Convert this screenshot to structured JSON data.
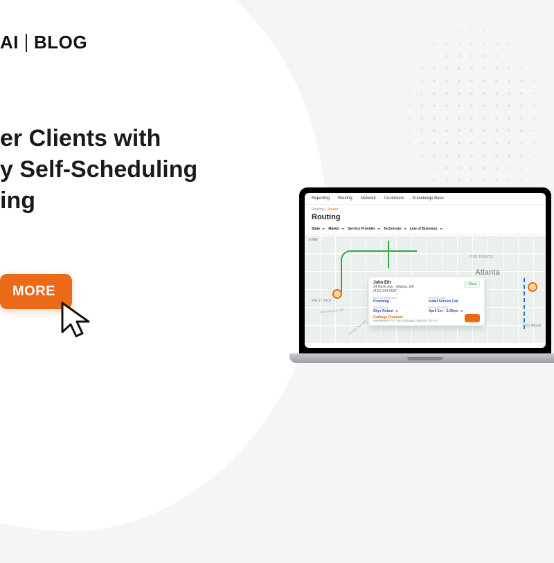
{
  "brand": {
    "prefix": "AI",
    "section": "BLOG"
  },
  "headline": {
    "line1": "er Clients with",
    "line2": "y Self-Scheduling",
    "line3": "ing"
  },
  "cta": {
    "label": "MORE"
  },
  "app": {
    "nav": {
      "reporting": "Reporting",
      "routing": "Routing",
      "network": "Network",
      "customers": "Customers",
      "knowledge": "Knowledge Base"
    },
    "breadcrumb": {
      "root": "Routing",
      "active": "Routes"
    },
    "page_title": "Routing",
    "filters": {
      "state": "State",
      "market": "Market",
      "provider": "Service Provider",
      "technician": "Technician",
      "lob": "Line of Business"
    },
    "map": {
      "city": "Atlanta",
      "nw": "e NW",
      "neighborhoods": {
        "fivepts": "FIVE POINTS",
        "westend": "WEST END",
        "zoo": "Zoo Atlanta"
      },
      "roads": {
        "donnelly": "Donnelly Ave SW",
        "murphy": "Murphy Ave SW"
      }
    },
    "info_card": {
      "name": "John Elit",
      "address": "34 North Ave · Atlanta, GA",
      "phone": "(416) 314-0537",
      "status": "Open",
      "fields": {
        "lob_label": "Line Of Business",
        "lob_value": "Plumbing",
        "service_label": "Service type",
        "service_value": "Initial Service Call",
        "tech_label": "Technician",
        "tech_value": "Skye Robert",
        "schedule_label": "Schedule time",
        "schedule_value": "April 1st – 2:00pm",
        "disposal_label": "Garbage Disposal",
        "disposal_value": "Insinkerator Pro 750 Garbage Disposer 3/4 Hp"
      }
    }
  }
}
